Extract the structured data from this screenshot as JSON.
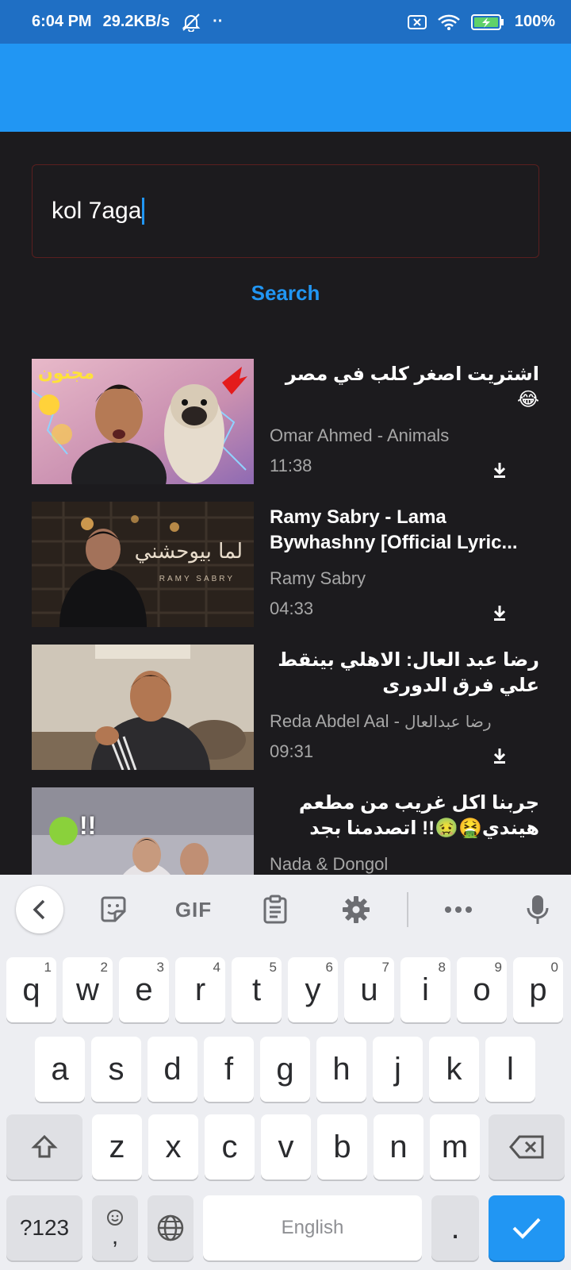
{
  "status_bar": {
    "time": "6:04 PM",
    "speed": "29.2KB/s",
    "dots": "··",
    "battery": "100%"
  },
  "search": {
    "value": "kol 7aga",
    "button_label": "Search"
  },
  "results": [
    {
      "title": "اشتريت اصغر كلب في مصر 😂",
      "channel": "Omar Ahmed - Animals",
      "duration": "11:38",
      "download_icon": "download-icon"
    },
    {
      "title_line1": "Ramy Sabry - Lama",
      "title_line2": "Bywhashny [Official Lyric...",
      "channel": "Ramy Sabry",
      "duration": "04:33",
      "thumb_text": "لما بيوحشني",
      "thumb_sub": "RAMY SABRY",
      "download_icon": "download-icon"
    },
    {
      "title": "رضا عبد العال: الاهلي بينقط علي فرق الدورى",
      "channel_latin": "Reda Abdel Aal - ",
      "channel_arabic": "رضا عبدالعال",
      "duration": "09:31",
      "download_icon": "download-icon"
    },
    {
      "title": "جربنا اكل غريب من مطعم هيندي🤮🤢!! اتصدمنا بجد",
      "channel": "Nada & Dongol",
      "thumb_text": "!!"
    }
  ],
  "thumb1_text": "مجنون",
  "keyboard": {
    "toolbar": {
      "gif": "GIF"
    },
    "row1": [
      {
        "k": "q",
        "h": "1"
      },
      {
        "k": "w",
        "h": "2"
      },
      {
        "k": "e",
        "h": "3"
      },
      {
        "k": "r",
        "h": "4"
      },
      {
        "k": "t",
        "h": "5"
      },
      {
        "k": "y",
        "h": "6"
      },
      {
        "k": "u",
        "h": "7"
      },
      {
        "k": "i",
        "h": "8"
      },
      {
        "k": "o",
        "h": "9"
      },
      {
        "k": "p",
        "h": "0"
      }
    ],
    "row2": [
      "a",
      "s",
      "d",
      "f",
      "g",
      "h",
      "j",
      "k",
      "l"
    ],
    "row3": [
      "z",
      "x",
      "c",
      "v",
      "b",
      "n",
      "m"
    ],
    "sym_label": "?123",
    "comma": ",",
    "space_label": "English",
    "period": "."
  },
  "colors": {
    "status_bar": "#1f6fc4",
    "app_bar": "#2196f3",
    "background": "#1c1b1e",
    "accent": "#2196f3",
    "field_border": "#5a1f1f"
  }
}
